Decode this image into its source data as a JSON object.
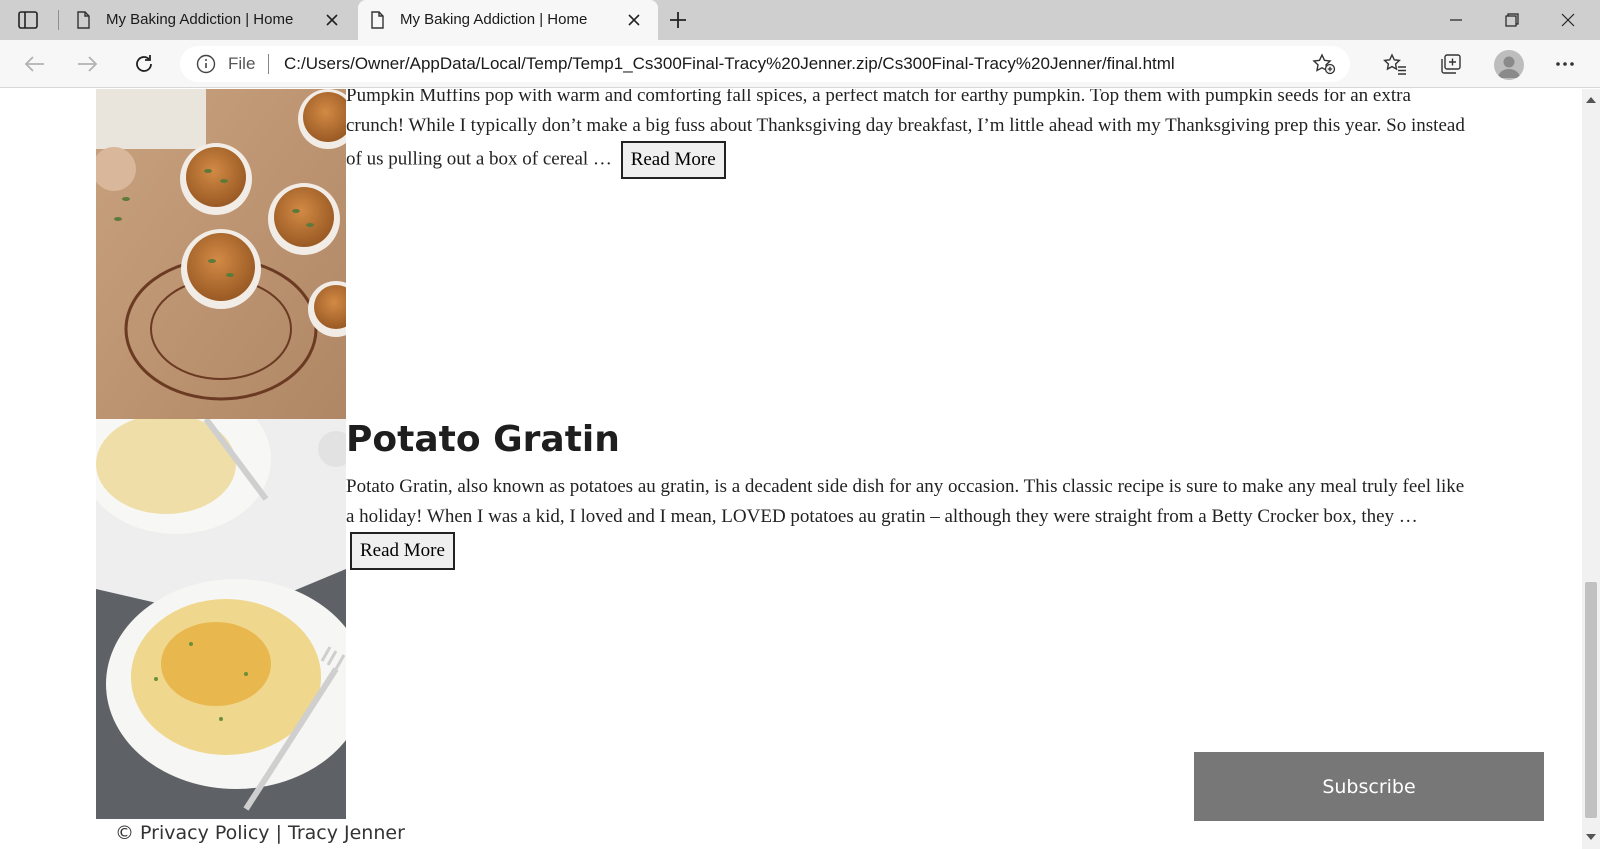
{
  "browser": {
    "tabs": [
      {
        "title": "My Baking Addiction | Home",
        "active": false
      },
      {
        "title": "My Baking Addiction | Home",
        "active": true
      }
    ],
    "address": {
      "scheme_label": "File",
      "url": "C:/Users/Owner/AppData/Local/Temp/Temp1_Cs300Final-Tracy%20Jenner.zip/Cs300Final-Tracy%20Jenner/final.html"
    }
  },
  "posts": [
    {
      "image_subject": "pumpkin muffins with pumpkin seeds on cooling rack",
      "excerpt_top": "Pumpkin Muffins pop with warm and comforting fall spices, a perfect match for earthy pumpkin. Top them with pumpkin seeds for an extra crunch! While I typically don’t make a big fuss about Thanksgiving day breakfast, I’m little ahead with my Thanksgiving prep this year. So instead of us pulling out a box of cereal …",
      "read_more": "Read More"
    },
    {
      "title": "Potato Gratin",
      "image_subject": "plates of potato gratin with forks",
      "excerpt": "Potato Gratin, also known as potatoes au gratin, is a decadent side dish for any occasion. This classic recipe is sure to make any meal truly feel like a holiday! When I was a kid, I loved and I mean, LOVED potatoes au gratin – although they were straight from a Betty Crocker box, they …",
      "read_more": "Read More"
    }
  ],
  "subscribe": {
    "label": "Subscribe"
  },
  "footer": {
    "text": "© Privacy Policy | Tracy Jenner"
  },
  "icons": {
    "tab_actions": "tab-actions-icon",
    "page": "page-icon",
    "close": "close-icon",
    "new_tab": "plus-icon",
    "minimize": "minimize-icon",
    "restore": "restore-icon",
    "close_window": "close-window-icon",
    "back": "back-arrow-icon",
    "forward": "forward-arrow-icon",
    "refresh": "refresh-icon",
    "info": "info-icon",
    "add_favorite": "add-favorite-icon",
    "favorites": "favorites-icon",
    "collections": "collections-icon",
    "profile": "profile-avatar-icon",
    "more": "more-icon"
  },
  "colors": {
    "tabstrip": "#cfcfcf",
    "active_tab": "#f7f7f7",
    "subscribe_bg": "#777777"
  }
}
